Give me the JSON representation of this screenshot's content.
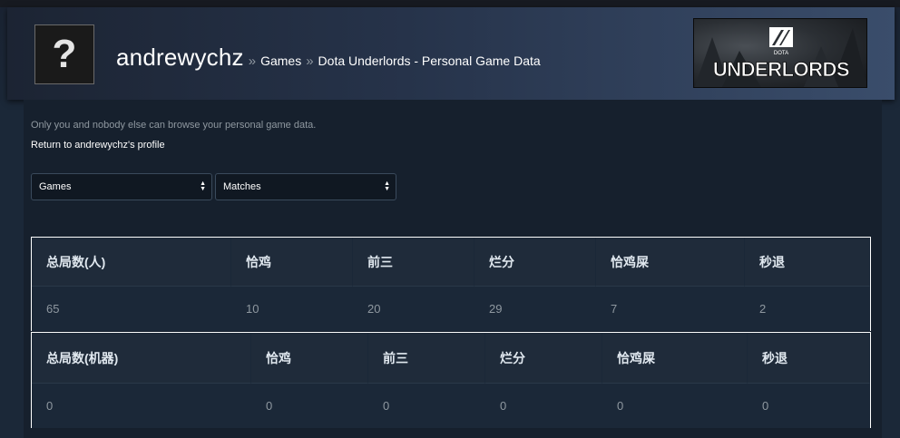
{
  "header": {
    "avatar_glyph": "?",
    "username": "andrewychz",
    "breadcrumb": [
      {
        "label": "Games"
      },
      {
        "label": "Dota Underlords - Personal Game Data"
      }
    ],
    "separator": "»",
    "logo": {
      "top_text": "DOTA",
      "main_text": "UNDERLORDS"
    }
  },
  "main": {
    "notice": "Only you and nobody else can browse your personal game data.",
    "return_link": "Return to andrewychz's profile",
    "dropdowns": [
      {
        "selected": "Games"
      },
      {
        "selected": "Matches"
      }
    ]
  },
  "tables": [
    {
      "headers": [
        "总局数(人)",
        "恰鸡",
        "前三",
        "烂分",
        "恰鸡屎",
        "秒退"
      ],
      "values": [
        "65",
        "10",
        "20",
        "29",
        "7",
        "2"
      ]
    },
    {
      "headers": [
        "总局数(机器)",
        "恰鸡",
        "前三",
        "烂分",
        "恰鸡屎",
        "秒退"
      ],
      "values": [
        "0",
        "0",
        "0",
        "0",
        "0",
        "0"
      ]
    }
  ]
}
